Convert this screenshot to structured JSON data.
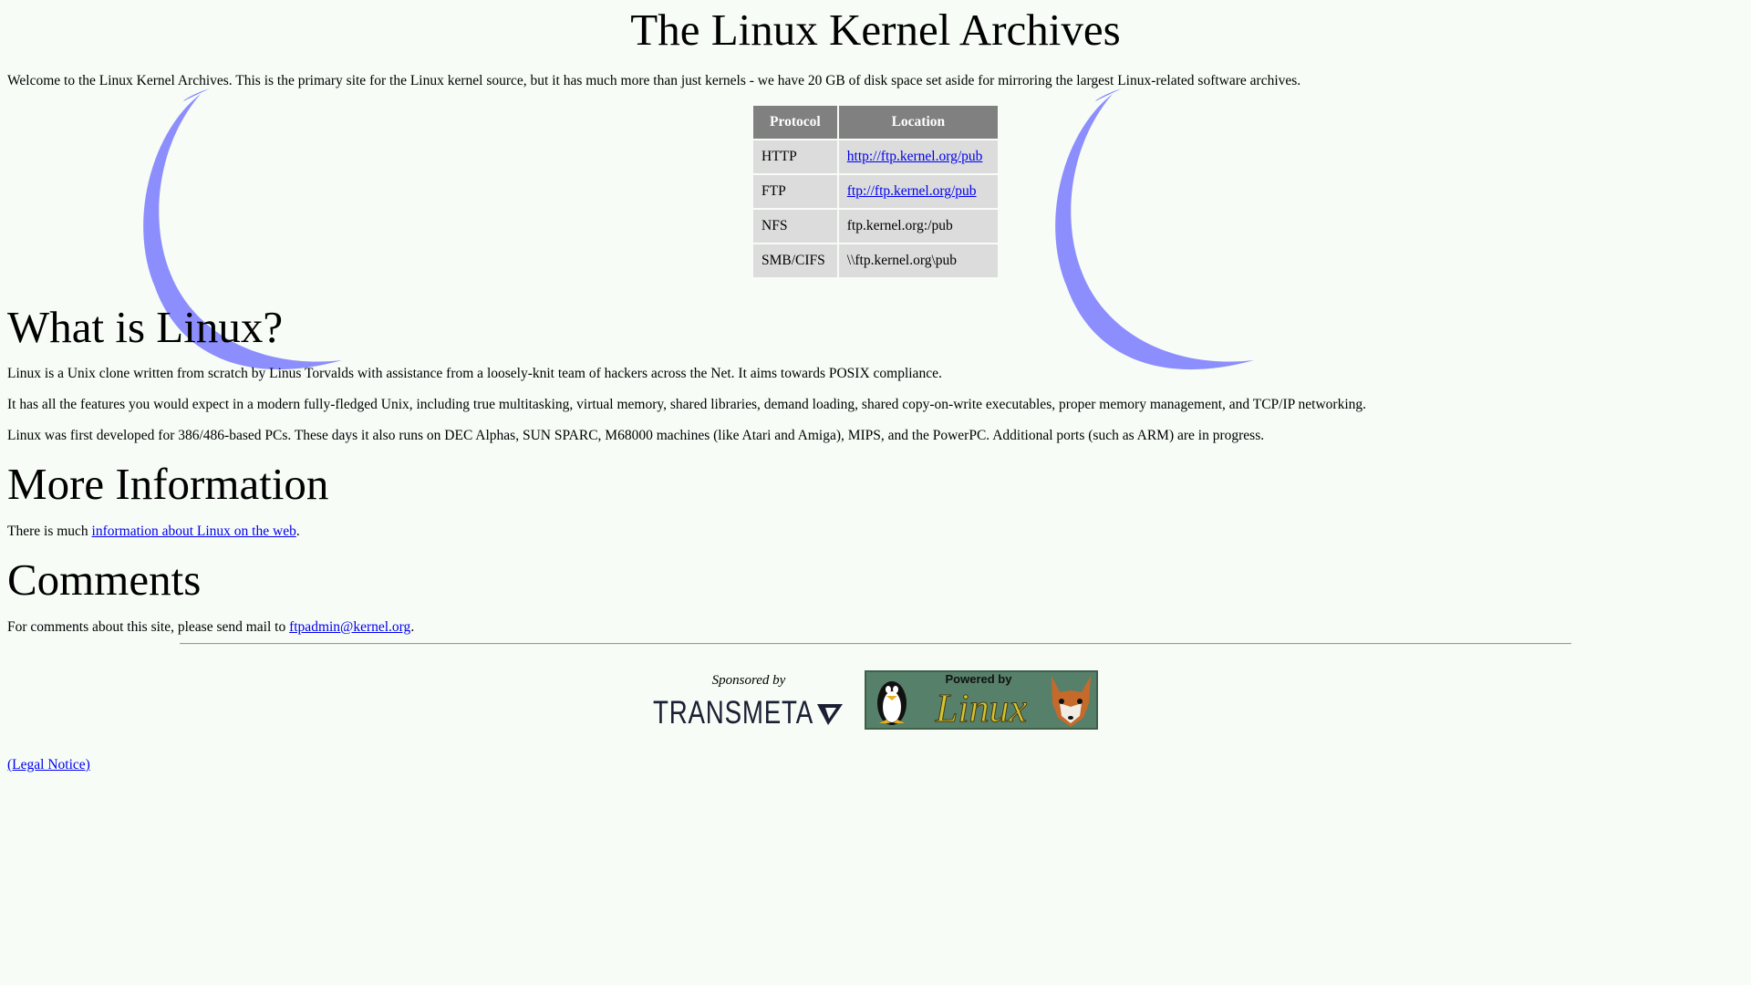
{
  "page": {
    "title": "The Linux Kernel Archives",
    "intro": "Welcome to the Linux Kernel Archives. This is the primary site for the Linux kernel source, but it has much more than just kernels - we have 20 GB of disk space set aside for mirroring the largest Linux-related software archives."
  },
  "protocols": {
    "header_protocol": "Protocol",
    "header_location": "Location",
    "rows": [
      {
        "protocol": "HTTP",
        "location": "http://ftp.kernel.org/pub"
      },
      {
        "protocol": "FTP",
        "location": "ftp://ftp.kernel.org/pub"
      },
      {
        "protocol": "NFS",
        "location": "ftp.kernel.org:/pub"
      },
      {
        "protocol": "SMB/CIFS",
        "location": "\\\\ftp.kernel.org\\pub"
      }
    ]
  },
  "what_is_linux": {
    "heading": "What is Linux?",
    "p1": "Linux is a Unix clone written from scratch by Linus Torvalds with assistance from a loosely-knit team of hackers across the Net. It aims towards POSIX compliance.",
    "p2": "It has all the features you would expect in a modern fully-fledged Unix, including true multitasking, virtual memory, shared libraries, demand loading, shared copy-on-write executables, proper memory management, and TCP/IP networking.",
    "p3": "Linux was first developed for 386/486-based PCs. These days it also runs on DEC Alphas, SUN SPARC, M68000 machines (like Atari and Amiga), MIPS, and the PowerPC. Additional ports (such as ARM) are in progress."
  },
  "more_info": {
    "heading": "More Information",
    "prefix": "There is much ",
    "link": "information about Linux on the web",
    "suffix": "."
  },
  "comments": {
    "heading": "Comments",
    "prefix": "For comments about this site, please send mail to ",
    "link": "ftpadmin@kernel.org",
    "suffix": "."
  },
  "footer": {
    "sponsored_by": "Sponsored by",
    "sponsor_name": "TRANSMETA",
    "powered_by": "Powered by",
    "powered_name": "Linux",
    "legal": "(Legal Notice)"
  },
  "colors": {
    "background": "#f7fcf7",
    "link": "#0000ee",
    "swoosh": "#5050ff",
    "table_header": "#808080",
    "table_cell": "#dcdcdc"
  }
}
